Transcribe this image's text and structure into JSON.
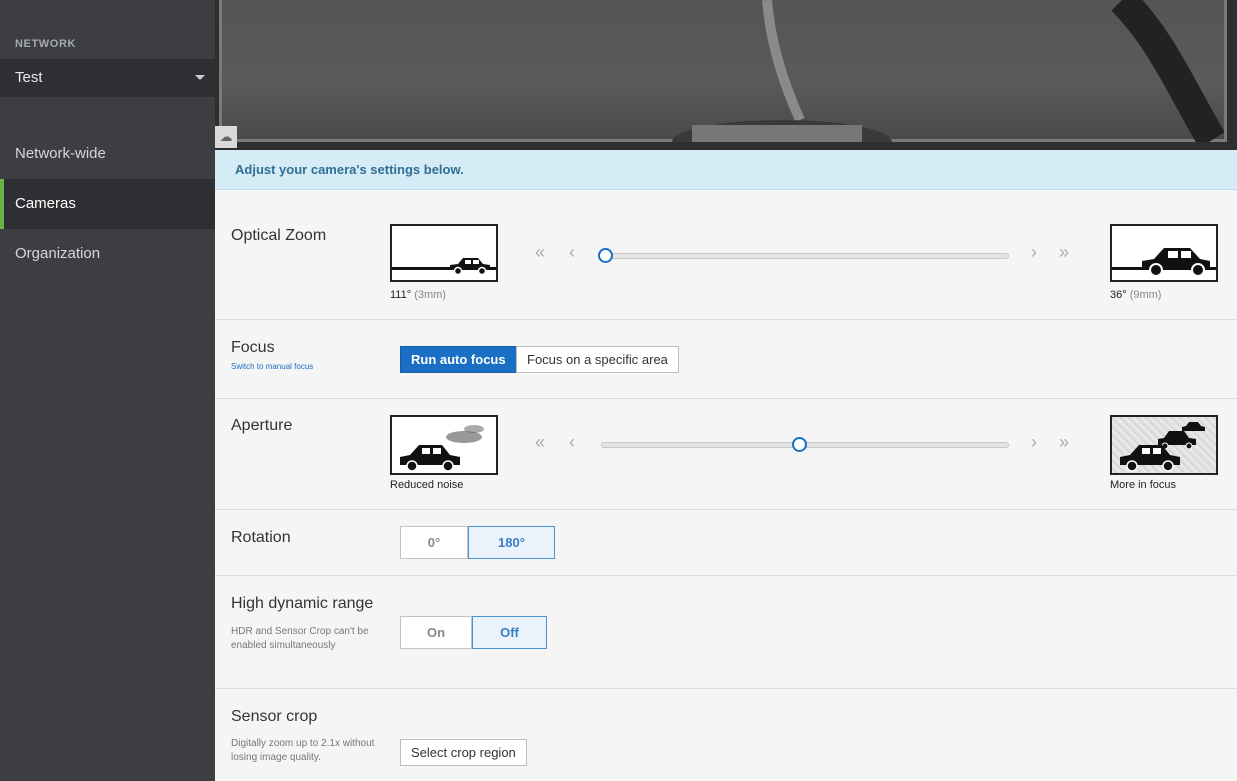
{
  "sidebar": {
    "network_label": "NETWORK",
    "network_value": "Test",
    "items": [
      {
        "label": "Network-wide",
        "active": false
      },
      {
        "label": "Cameras",
        "active": true
      },
      {
        "label": "Organization",
        "active": false
      }
    ]
  },
  "banner": {
    "text": "Adjust your camera's settings below."
  },
  "optical_zoom": {
    "title": "Optical Zoom",
    "wide_angle": "111°",
    "wide_mm": "(3mm)",
    "tele_angle": "36°",
    "tele_mm": "(9mm)",
    "slider_value": 0
  },
  "focus": {
    "title": "Focus",
    "manual_link": "Switch to manual focus",
    "auto_button": "Run auto focus",
    "area_button": "Focus on a specific area"
  },
  "aperture": {
    "title": "Aperture",
    "left_caption": "Reduced noise",
    "right_caption": "More in focus",
    "slider_value": 0.49
  },
  "rotation": {
    "title": "Rotation",
    "options": [
      "0°",
      "180°"
    ],
    "selected": "180°"
  },
  "hdr": {
    "title": "High dynamic range",
    "note": "HDR and Sensor Crop can't be enabled simultaneously",
    "options": [
      "On",
      "Off"
    ],
    "selected": "Off"
  },
  "sensor_crop": {
    "title": "Sensor crop",
    "note": "Digitally zoom up to 2.1x without losing image quality.",
    "button": "Select crop region"
  },
  "colors": {
    "accent": "#1a6fc4",
    "sidebar": "#3c3e42",
    "active_marker": "#67b346",
    "banner": "#d5ebf5"
  }
}
